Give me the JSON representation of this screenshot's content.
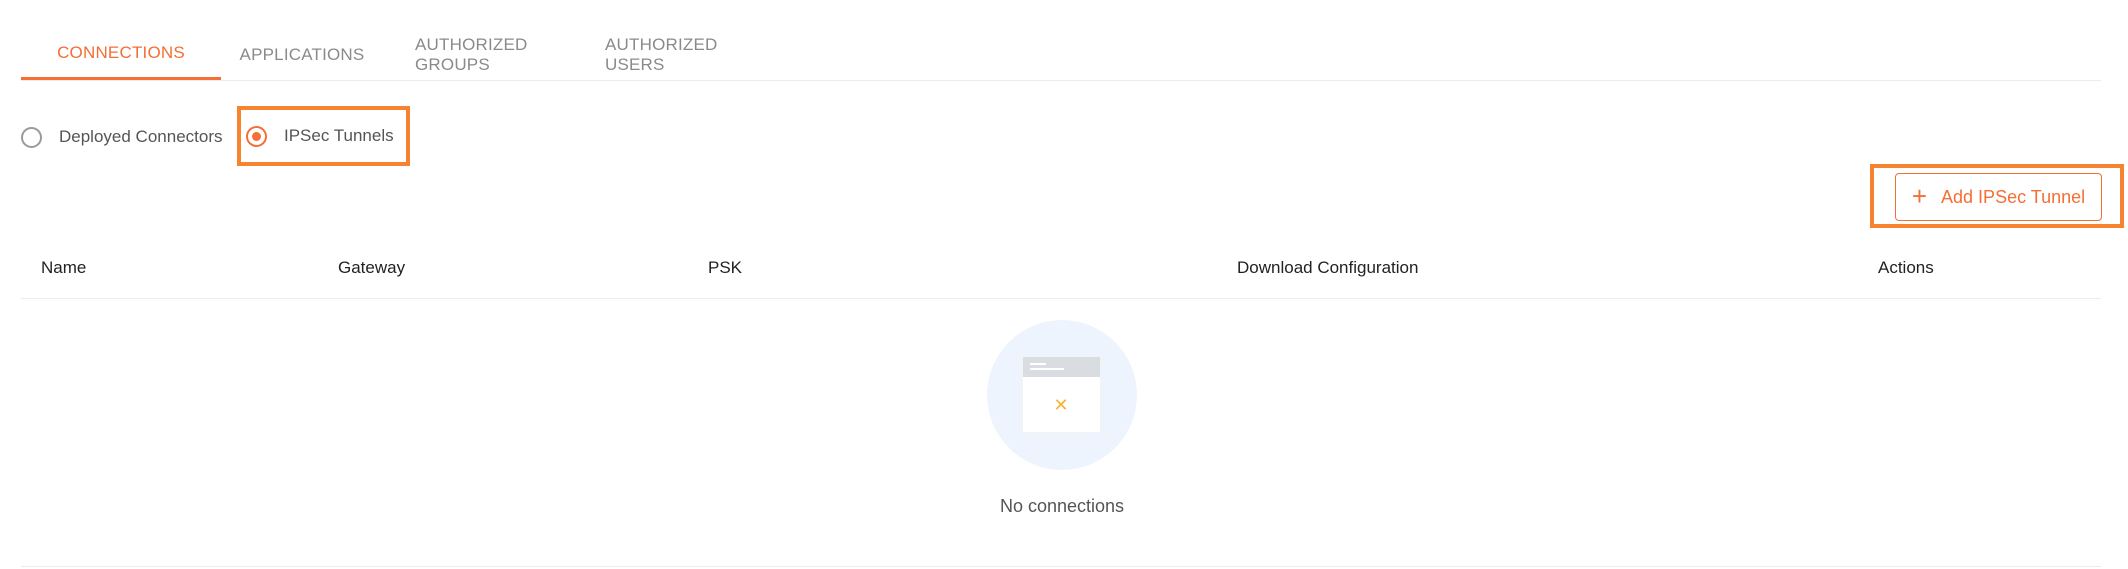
{
  "tabs": [
    {
      "label": "CONNECTIONS",
      "active": true
    },
    {
      "label": "APPLICATIONS",
      "active": false
    },
    {
      "label": "AUTHORIZED GROUPS",
      "active": false
    },
    {
      "label": "AUTHORIZED USERS",
      "active": false
    }
  ],
  "connection_type": {
    "options": [
      {
        "label": "Deployed Connectors",
        "selected": false
      },
      {
        "label": "IPSec Tunnels",
        "selected": true
      }
    ]
  },
  "toolbar": {
    "add_label": "Add IPSec Tunnel",
    "add_icon": "plus-icon"
  },
  "table": {
    "columns": [
      "Name",
      "Gateway",
      "PSK",
      "Download Configuration",
      "Actions"
    ],
    "rows": []
  },
  "empty_state": {
    "message": "No connections",
    "icon": "empty-document-icon"
  },
  "colors": {
    "accent": "#f46e35",
    "highlight": "#f6832f",
    "empty_bg": "#eef4fd",
    "empty_x": "#f5b533"
  }
}
